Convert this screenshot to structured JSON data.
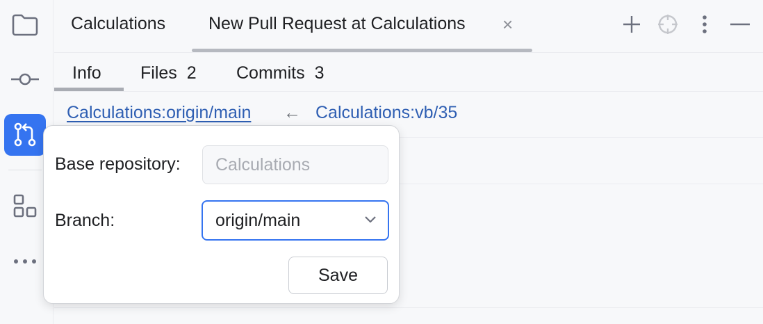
{
  "header": {
    "tabs": [
      {
        "label": "Calculations"
      },
      {
        "label": "New Pull Request at Calculations"
      }
    ],
    "close_glyph": "×",
    "actions": [
      "plus-icon",
      "target-icon",
      "more-vertical-icon",
      "minimize-icon"
    ]
  },
  "toolstrip": {
    "items": [
      "folder-icon",
      "commit-icon",
      "pull-request-icon",
      "structure-icon",
      "more-horizontal-icon"
    ],
    "active": "pull-request-icon"
  },
  "subtabs": [
    {
      "label": "Info",
      "count": ""
    },
    {
      "label": "Files",
      "count": "2"
    },
    {
      "label": "Commits",
      "count": "3"
    }
  ],
  "branches": {
    "base": "Calculations:origin/main",
    "arrow": "←",
    "head": "Calculations:vb/35"
  },
  "popup": {
    "base_repo_label": "Base repository:",
    "base_repo_placeholder": "Calculations",
    "branch_label": "Branch:",
    "branch_value": "origin/main",
    "save_label": "Save"
  },
  "colors": {
    "accent": "#3574f0",
    "link": "#2f5fb3"
  }
}
